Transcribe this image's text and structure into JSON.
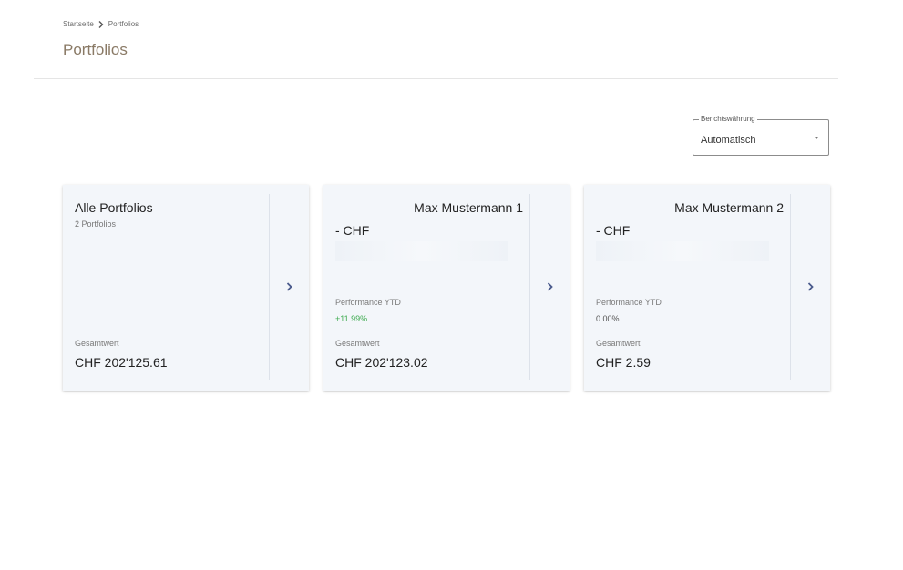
{
  "breadcrumb": {
    "home": "Startseite",
    "current": "Portfolios"
  },
  "page": {
    "title": "Portfolios"
  },
  "currency_select": {
    "label": "Berichtswährung",
    "value": "Automatisch"
  },
  "cards": [
    {
      "title": "Alle Portfolios",
      "subtitle": "2 Portfolios",
      "total_label": "Gesamtwert",
      "total_value": "CHF 202'125.61"
    },
    {
      "title": "Max Mustermann 1",
      "currency": "- CHF",
      "performance_label": "Performance YTD",
      "performance_value": "+11.99%",
      "total_label": "Gesamtwert",
      "total_value": "CHF 202'123.02"
    },
    {
      "title": "Max Mustermann 2",
      "currency": "- CHF",
      "performance_label": "Performance YTD",
      "performance_value": "0.00%",
      "total_label": "Gesamtwert",
      "total_value": "CHF 2.59"
    }
  ],
  "colors": {
    "title_brown": "#8a7a66",
    "card_bg": "#f3f6fa",
    "arrow_blue": "#4a5a8c",
    "performance_positive": "#3dab4f",
    "performance_neutral": "#555555"
  },
  "icons": {
    "breadcrumb_separator": "chevron-right-icon",
    "select_dropdown": "caret-down-icon",
    "card_arrow": "chevron-right-icon"
  }
}
